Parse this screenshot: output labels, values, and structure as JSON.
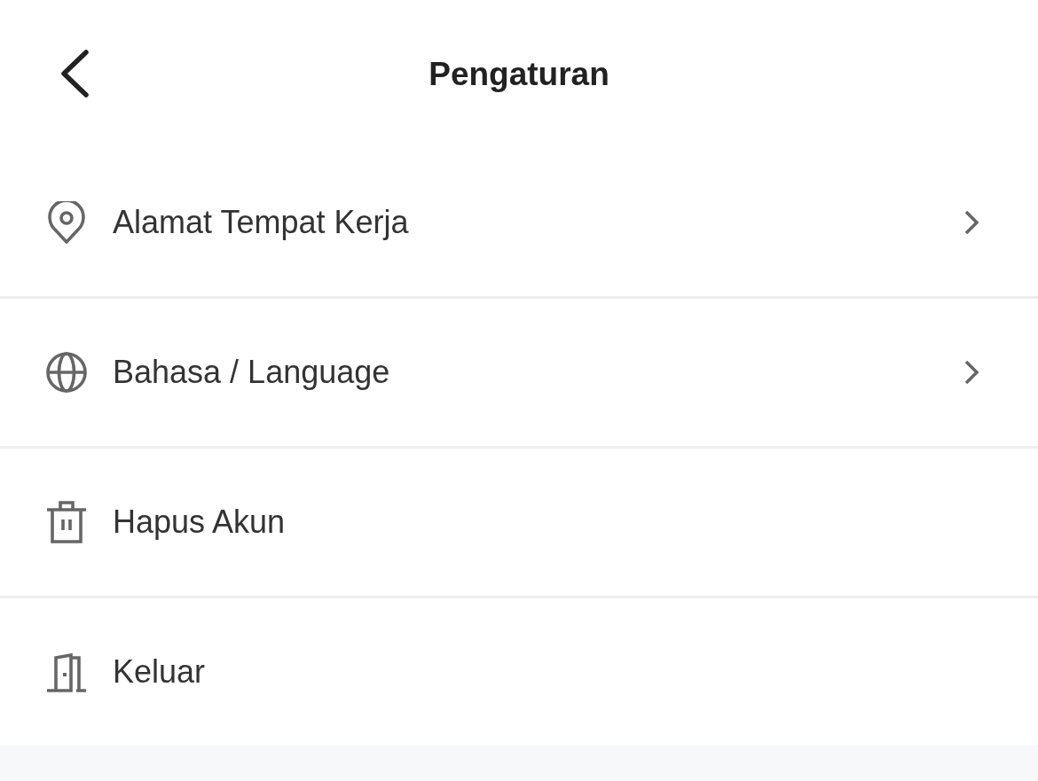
{
  "header": {
    "title": "Pengaturan"
  },
  "menu": [
    {
      "label": "Alamat Tempat Kerja",
      "kind": "navigate"
    },
    {
      "label": "Bahasa / Language",
      "kind": "navigate"
    },
    {
      "label": "Hapus Akun",
      "kind": "action"
    },
    {
      "label": "Keluar",
      "kind": "action"
    }
  ]
}
